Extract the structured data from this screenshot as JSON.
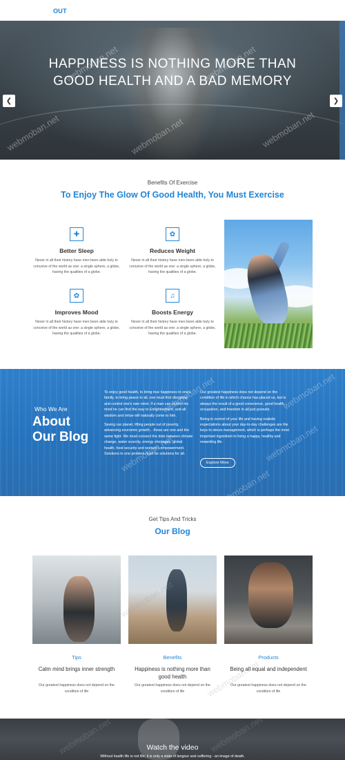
{
  "header": {
    "nav_label": "OUT"
  },
  "hero": {
    "headline": "HAPPINESS IS NOTHING MORE THAN GOOD HEALTH AND A BAD MEMORY",
    "watermark": "webmoban.net"
  },
  "benefits": {
    "subtitle": "Benefits Of Exercise",
    "title": "To Enjoy The Glow Of Good Health, You Must Exercise",
    "items": [
      {
        "icon": "plus-icon",
        "title": "Better Sleep",
        "desc": "Never in all their history have men been able truly to conceive of the world as one: a single sphere, a globe, having the qualities of a globe."
      },
      {
        "icon": "leaf-icon",
        "title": "Reduces Weight",
        "desc": "Never in all their history have men been able truly to conceive of the world as one: a single sphere, a globe, having the qualities of a globe."
      },
      {
        "icon": "leaf-icon",
        "title": "Improves Mood",
        "desc": "Never in all their history have men been able truly to conceive of the world as one: a single sphere, a globe, having the qualities of a globe."
      },
      {
        "icon": "bell-icon",
        "title": "Boosts Energy",
        "desc": "Never in all their history have men been able truly to conceive of the world as one: a single sphere, a globe, having the qualities of a globe."
      }
    ]
  },
  "about": {
    "label": "Who We Are",
    "title": "About Our Blog",
    "col1_p1": "To enjoy good health, to bring true happiness to one's family, to bring peace to all, one must first discipline and control one's own mind. If a man can control his mind he can find the way to Enlightenment, and all wisdom and virtue will naturally come to him.",
    "col1_p2": "Saving our planet, lifting people out of poverty, advancing economic growth... these are one and the same fight. We must connect the dots between climate change, water scarcity, energy shortages, global health, food security and women's empowerment. Solutions to one problem must be solutions for all.",
    "col2_p1": "Our greatest happiness does not depend on the condition of life in which chance has placed us, but is always the result of a good conscience, good health, occupation, and freedom in all just pursuits.",
    "col2_p2": "Being in control of your life and having realistic expectations about your day-to-day challenges are the keys to stress management, which is perhaps the most important ingredient to living a happy, healthy and rewarding life.",
    "button": "Explore More"
  },
  "blog": {
    "subtitle": "Get Tips And Tricks",
    "title": "Our Blog",
    "cards": [
      {
        "category": "Tips",
        "title": "Calm mind brings inner strength",
        "desc": "Our greatest happiness does not depend on the condition of life"
      },
      {
        "category": "Benefits",
        "title": "Happiness is nothing more than good health",
        "desc": "Our greatest happiness does not depend on the condition of life"
      },
      {
        "category": "Products",
        "title": "Being all equal and independent",
        "desc": "Our greatest happiness does not depend on the condition of life"
      }
    ]
  },
  "video": {
    "title": "Watch the video",
    "desc": "Without health life is not life; it is only a state of langour and suffering - an image of death."
  }
}
